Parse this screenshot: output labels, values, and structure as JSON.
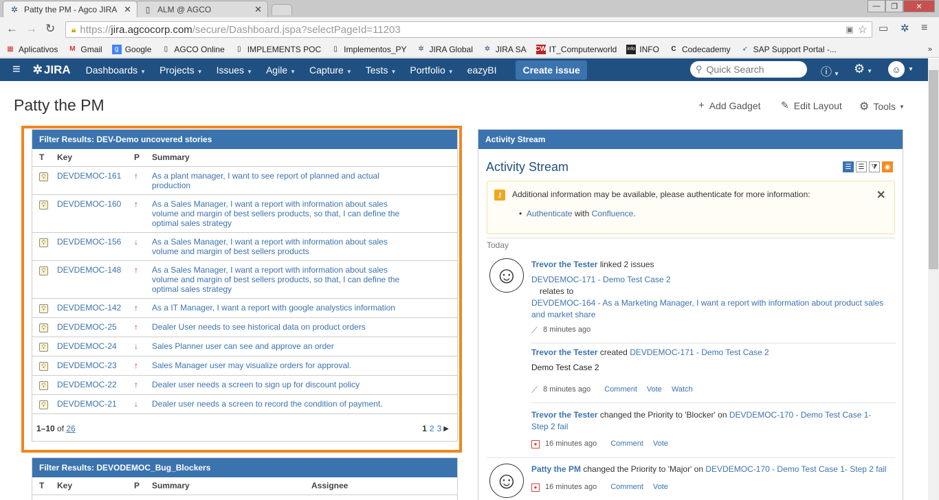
{
  "browser": {
    "tabs": [
      {
        "title": "Patty the PM - Agco JIRA"
      },
      {
        "title": "ALM @ AGCO"
      }
    ],
    "url_scheme": "https://",
    "url_host": "jira.agcocorp.com",
    "url_path": "/secure/Dashboard.jspa?selectPageId=11203",
    "bookmarks": [
      "Aplicativos",
      "Gmail",
      "Google",
      "AGCO Online",
      "IMPLEMENTS POC",
      "Implementos_PY",
      "JIRA Global",
      "JIRA SA",
      "IT_Computerworld",
      "INFO",
      "Codecademy",
      "SAP Support Portal -..."
    ]
  },
  "jira": {
    "logo": "JIRA",
    "nav": [
      "Dashboards",
      "Projects",
      "Issues",
      "Agile",
      "Capture",
      "Tests",
      "Portfolio",
      "eazyBI"
    ],
    "create": "Create issue",
    "search_placeholder": "Quick Search"
  },
  "page": {
    "title": "Patty the PM",
    "tools": {
      "add_gadget": "Add Gadget",
      "edit_layout": "Edit Layout",
      "tools": "Tools"
    }
  },
  "filter1": {
    "title": "Filter Results: DEV-Demo uncovered stories",
    "columns": [
      "T",
      "Key",
      "P",
      "Summary"
    ],
    "rows": [
      {
        "key": "DEVDEMOC-161",
        "pri": "up",
        "summary": "As a plant manager, I want to see report of planned and actual production"
      },
      {
        "key": "DEVDEMOC-160",
        "pri": "up",
        "summary": "As a Sales Manager, I want a report with information about sales volume and margin of best sellers products, so that, I can define the optimal sales strategy"
      },
      {
        "key": "DEVDEMOC-156",
        "pri": "down",
        "summary": "As a Sales Manager, I want a report with information about sales volume and margin of best sellers products"
      },
      {
        "key": "DEVDEMOC-148",
        "pri": "up",
        "summary": "As a Sales Manager, I want a report with information about sales volume and margin of best sellers products, so that, I can define the optimal sales strategy"
      },
      {
        "key": "DEVDEMOC-142",
        "pri": "up",
        "summary": "As a IT Manager, I want a report with google analystics information"
      },
      {
        "key": "DEVDEMOC-25",
        "pri": "up",
        "summary": "Dealer User needs to see historical data on product orders"
      },
      {
        "key": "DEVDEMOC-24",
        "pri": "down",
        "summary": "Sales Planner user can see and approve an order"
      },
      {
        "key": "DEVDEMOC-23",
        "pri": "up",
        "summary": "Sales Manager user may visualize orders for approval."
      },
      {
        "key": "DEVDEMOC-22",
        "pri": "up",
        "summary": "Dealer user needs a screen to sign up for discount policy"
      },
      {
        "key": "DEVDEMOC-21",
        "pri": "down",
        "summary": "Dealer user needs a screen to record the condition of payment."
      }
    ],
    "range": "1–10",
    "of": "of",
    "total": "26",
    "pages": [
      "1",
      "2",
      "3"
    ]
  },
  "filter2": {
    "title": "Filter Results: DEVODEMOC_Bug_Blockers",
    "columns": [
      "T",
      "Key",
      "P",
      "Summary",
      "Assignee"
    ]
  },
  "activity": {
    "header": "Activity Stream",
    "title": "Activity Stream",
    "notice": "Additional information may be available, please authenticate for more information:",
    "auth_link": "Authenticate",
    "auth_with": "with",
    "confluence": "Confluence",
    "today": "Today",
    "items": [
      {
        "user": "Trevor the Tester",
        "verb": "linked 2 issues",
        "issue1": "DEVDEMOC-171 - Demo Test Case 2",
        "relates": "relates to",
        "issue2": "DEVDEMOC-164 - As a Marketing Manager, I want a report with information about product sales and market share",
        "time": "8 minutes ago"
      },
      {
        "user": "Trevor the Tester",
        "verb": "created",
        "issue": "DEVDEMOC-171 - Demo Test Case 2",
        "body": "Demo Test Case 2",
        "time": "8 minutes ago",
        "actions": [
          "Comment",
          "Vote",
          "Watch"
        ]
      },
      {
        "user": "Trevor the Tester",
        "verb": "changed the Priority to 'Blocker' on",
        "issue": "DEVDEMOC-170 - Demo Test Case 1- Step 2 fail",
        "time": "16 minutes ago",
        "actions": [
          "Comment",
          "Vote"
        ]
      },
      {
        "user": "Patty the PM",
        "verb": "changed the Priority to 'Major' on",
        "issue": "DEVDEMOC-170 - Demo Test Case 1- Step 2 fail",
        "time": "16 minutes ago",
        "actions": [
          "Comment",
          "Vote"
        ]
      }
    ]
  },
  "colors": {
    "jira_header": "#205081",
    "gadget_header": "#3b73af",
    "highlight": "#f0861e"
  }
}
